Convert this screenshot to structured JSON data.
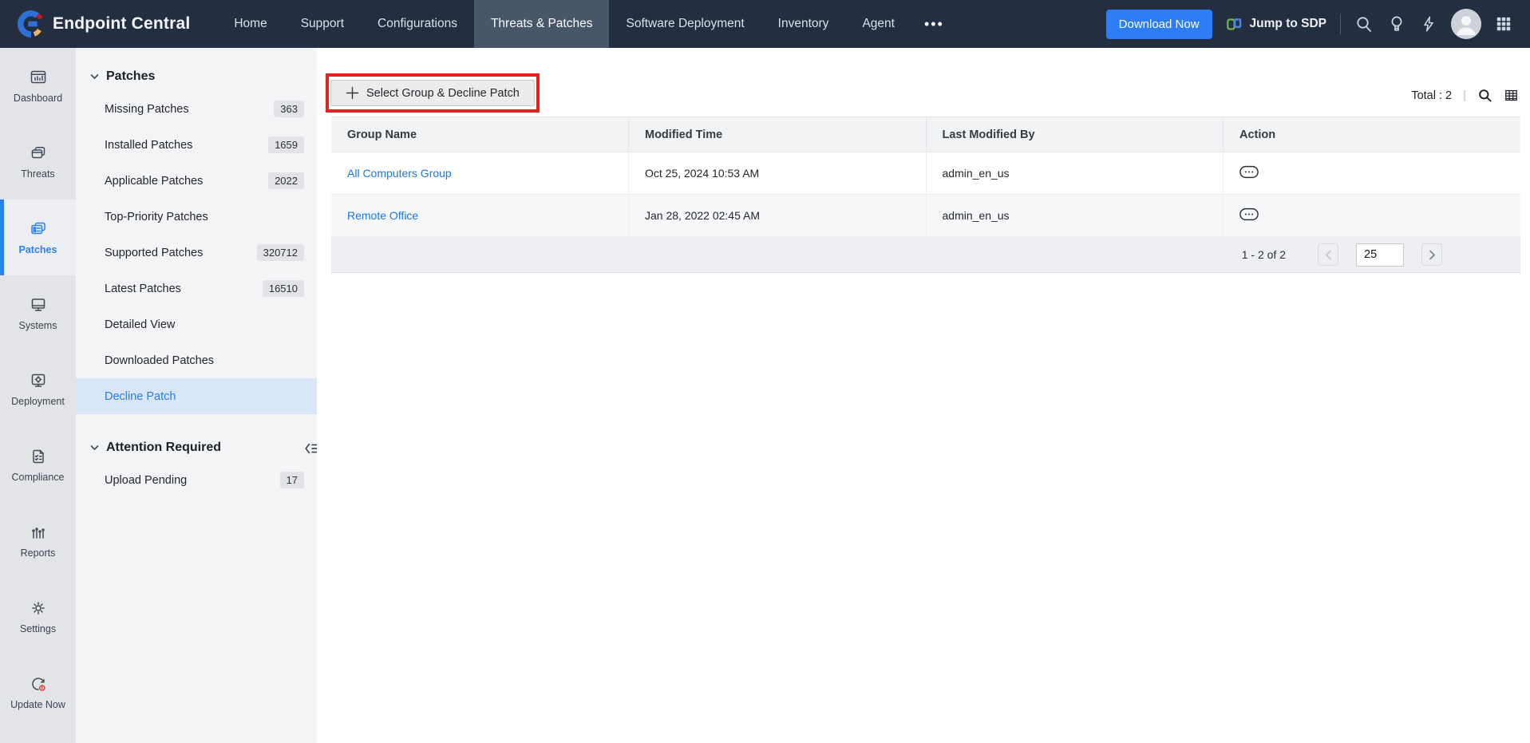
{
  "topnav": {
    "brand": "Endpoint Central",
    "items": [
      {
        "label": "Home"
      },
      {
        "label": "Support"
      },
      {
        "label": "Configurations"
      },
      {
        "label": "Threats & Patches"
      },
      {
        "label": "Software Deployment"
      },
      {
        "label": "Inventory"
      },
      {
        "label": "Agent"
      }
    ],
    "more_label": "•••",
    "download_button": "Download Now",
    "jump_to_sdp": "Jump to SDP"
  },
  "rail": {
    "items": [
      {
        "label": "Dashboard"
      },
      {
        "label": "Threats"
      },
      {
        "label": "Patches"
      },
      {
        "label": "Systems"
      },
      {
        "label": "Deployment"
      },
      {
        "label": "Compliance"
      },
      {
        "label": "Reports"
      },
      {
        "label": "Settings"
      },
      {
        "label": "Update Now"
      }
    ]
  },
  "panel": {
    "patches_section": {
      "title": "Patches",
      "items": [
        {
          "label": "Missing Patches",
          "badge": "363"
        },
        {
          "label": "Installed Patches",
          "badge": "1659"
        },
        {
          "label": "Applicable Patches",
          "badge": "2022"
        },
        {
          "label": "Top-Priority Patches",
          "badge": ""
        },
        {
          "label": "Supported Patches",
          "badge": "320712"
        },
        {
          "label": "Latest Patches",
          "badge": "16510"
        },
        {
          "label": "Detailed View",
          "badge": ""
        },
        {
          "label": "Downloaded Patches",
          "badge": ""
        },
        {
          "label": "Decline Patch",
          "badge": ""
        }
      ]
    },
    "attention_section": {
      "title": "Attention Required",
      "items": [
        {
          "label": "Upload Pending",
          "badge": "17"
        }
      ]
    }
  },
  "main": {
    "select_button": "Select Group & Decline Patch",
    "total_label": "Total : 2",
    "meta_separator": "|",
    "table": {
      "columns": [
        "Group Name",
        "Modified Time",
        "Last Modified By",
        "Action"
      ],
      "rows": [
        {
          "group": "All Computers Group",
          "modified": "Oct 25, 2024 10:53 AM",
          "by": "admin_en_us"
        },
        {
          "group": "Remote Office",
          "modified": "Jan 28, 2022 02:45 AM",
          "by": "admin_en_us"
        }
      ],
      "pagination": {
        "range": "1 - 2 of 2",
        "page_size": "25"
      }
    }
  },
  "colors": {
    "navbar_bg": "#232f40",
    "active_tab_bg": "#475669",
    "accent_blue": "#2e7cf6",
    "link_blue": "#1e78d6",
    "annotation_red": "#e42320",
    "panel_active_bg": "#d9e6f7",
    "badge_bg": "#e2e3e7"
  }
}
